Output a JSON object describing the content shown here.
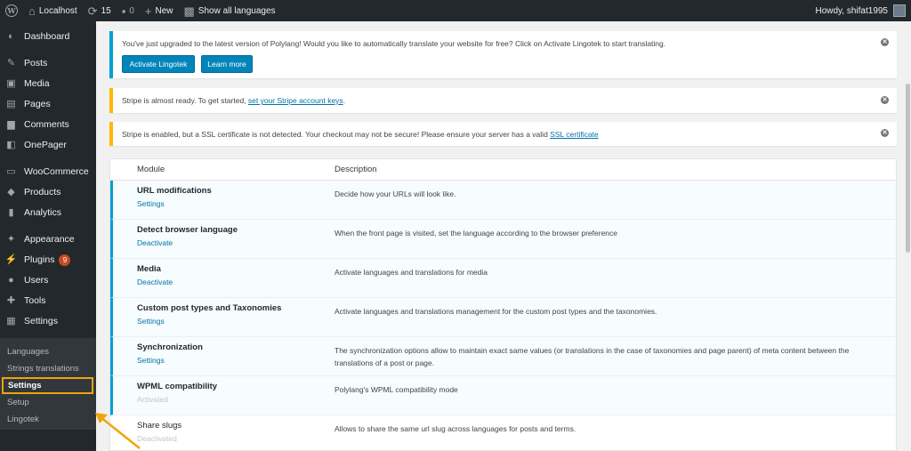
{
  "adminbar": {
    "site_name": "Localhost",
    "updates_count": "15",
    "comments_count": "0",
    "new_label": "New",
    "languages_label": "Show all languages",
    "howdy": "Howdy, shifat1995"
  },
  "sidebar": {
    "items": [
      {
        "label": "Dashboard",
        "icon": "dashboard-icon",
        "glyph": "◐"
      },
      {
        "label": "Posts",
        "icon": "pin-icon",
        "glyph": "✎"
      },
      {
        "label": "Media",
        "icon": "media-icon",
        "glyph": "▣"
      },
      {
        "label": "Pages",
        "icon": "pages-icon",
        "glyph": "▤"
      },
      {
        "label": "Comments",
        "icon": "comments-icon",
        "glyph": "▆"
      },
      {
        "label": "OnePager",
        "icon": "onepager-icon",
        "glyph": "◧"
      },
      {
        "label": "WooCommerce",
        "icon": "woocommerce-icon",
        "glyph": "▭"
      },
      {
        "label": "Products",
        "icon": "products-icon",
        "glyph": "◆"
      },
      {
        "label": "Analytics",
        "icon": "analytics-icon",
        "glyph": "▮"
      },
      {
        "label": "Appearance",
        "icon": "appearance-icon",
        "glyph": "✦"
      },
      {
        "label": "Plugins",
        "icon": "plugins-icon",
        "glyph": "⚡",
        "badge": "9"
      },
      {
        "label": "Users",
        "icon": "users-icon",
        "glyph": "●"
      },
      {
        "label": "Tools",
        "icon": "tools-icon",
        "glyph": "✚"
      },
      {
        "label": "Settings",
        "icon": "settings-icon",
        "glyph": "▦"
      },
      {
        "label": "Languages",
        "icon": "languages-icon",
        "glyph": "▩"
      }
    ],
    "submenu": [
      "Languages",
      "Strings translations",
      "Settings",
      "Setup",
      "Lingotek"
    ]
  },
  "notices": {
    "lingotek_text": "You've just upgraded to the latest version of Polylang! Would you like to automatically translate your website for free? Click on Activate Lingotek to start translating.",
    "activate_button": "Activate Lingotek",
    "learn_button": "Learn more",
    "stripe_text": "Stripe is almost ready. To get started,",
    "stripe_link": "set your Stripe account keys",
    "ssl_text": "Stripe is enabled, but a SSL certificate is not detected. Your checkout may not be secure! Please ensure your server has a valid",
    "ssl_link": "SSL certificate"
  },
  "modules": {
    "col_module": "Module",
    "col_description": "Description",
    "rows": [
      {
        "name": "URL modifications",
        "link": "Settings",
        "description": "Decide how your URLs will look like."
      },
      {
        "name": "Detect browser language",
        "link": "Deactivate",
        "description": "When the front page is visited, set the language according to the browser preference"
      },
      {
        "name": "Media",
        "link": "Deactivate",
        "description": "Activate languages and translations for media"
      },
      {
        "name": "Custom post types and Taxonomies",
        "link": "Settings",
        "description": "Activate languages and translations management for the custom post types and the taxonomies."
      },
      {
        "name": "Synchronization",
        "link": "Settings",
        "description": "The synchronization options allow to maintain exact same values (or translations in the case of taxonomies and page parent) of meta content between the translations of a post or page."
      },
      {
        "name": "WPML compatibility",
        "link": "Activated",
        "description": "Polylang's WPML compatibility mode"
      },
      {
        "name": "Share slugs",
        "link": "Deactivated",
        "description": "Allows to share the same url slug across languages for posts and terms."
      }
    ]
  }
}
